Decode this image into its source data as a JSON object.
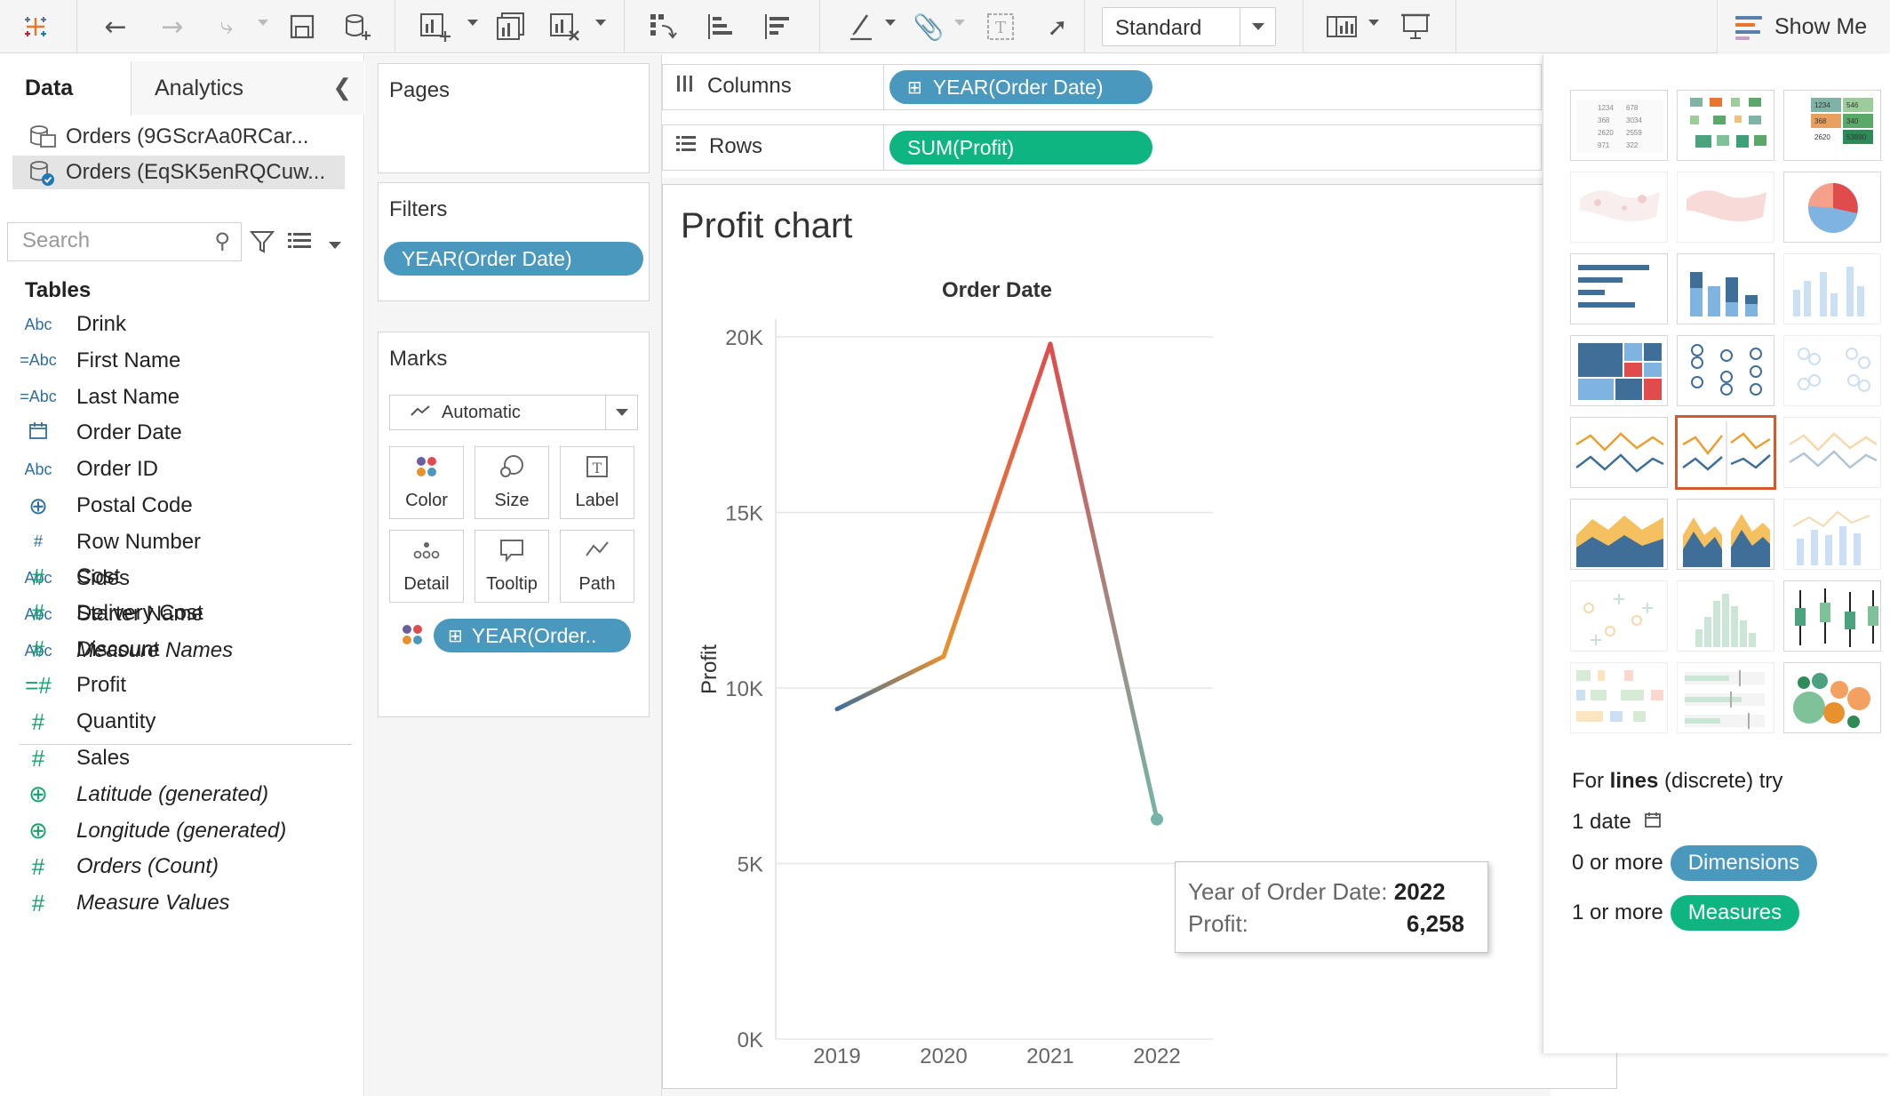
{
  "toolbar": {
    "layout_mode": "Standard",
    "show_me_label": "Show Me"
  },
  "left_panel": {
    "tabs": {
      "data": "Data",
      "analytics": "Analytics"
    },
    "data_sources": [
      {
        "label": "Orders (9GScrAa0RCar...",
        "selected": false
      },
      {
        "label": "Orders (EqSK5enRQCuw...",
        "selected": true
      }
    ],
    "search_placeholder": "Search",
    "tables_header": "Tables",
    "dimensions": [
      {
        "type": "Abc",
        "name": "Drink"
      },
      {
        "type": "=Abc",
        "name": "First Name"
      },
      {
        "type": "=Abc",
        "name": "Last Name"
      },
      {
        "type": "date",
        "name": "Order Date"
      },
      {
        "type": "Abc",
        "name": "Order ID"
      },
      {
        "type": "geo",
        "name": "Postal Code"
      },
      {
        "type": "#",
        "name": "Row Number"
      },
      {
        "type": "Abc",
        "name": "Sides"
      },
      {
        "type": "Abc",
        "name": "Starter Name"
      },
      {
        "type": "Abc",
        "name": "Measure Names",
        "italic": true
      }
    ],
    "measures": [
      {
        "type": "#",
        "name": "Cost"
      },
      {
        "type": "#",
        "name": "Delivery Cost"
      },
      {
        "type": "#",
        "name": "Discount"
      },
      {
        "type": "=#",
        "name": "Profit"
      },
      {
        "type": "#",
        "name": "Quantity"
      },
      {
        "type": "#",
        "name": "Sales"
      },
      {
        "type": "geo",
        "name": "Latitude (generated)",
        "italic": true
      },
      {
        "type": "geo",
        "name": "Longitude (generated)",
        "italic": true
      },
      {
        "type": "#",
        "name": "Orders (Count)",
        "italic": true
      },
      {
        "type": "#",
        "name": "Measure Values",
        "italic": true
      }
    ]
  },
  "cards": {
    "pages_title": "Pages",
    "filters_title": "Filters",
    "filter_pill": "YEAR(Order Date)",
    "marks_title": "Marks",
    "marks_type": "Automatic",
    "mark_buttons": {
      "color": "Color",
      "size": "Size",
      "label": "Label",
      "detail": "Detail",
      "tooltip": "Tooltip",
      "path": "Path"
    },
    "color_pill": "YEAR(Order.."
  },
  "shelves": {
    "columns_label": "Columns",
    "columns_pill": "YEAR(Order Date)",
    "rows_label": "Rows",
    "rows_pill": "SUM(Profit)"
  },
  "viz": {
    "title": "Profit chart",
    "header": "Order Date"
  },
  "chart_data": {
    "type": "line",
    "title": "Profit chart",
    "xlabel": "Order Date",
    "ylabel": "Profit",
    "categories": [
      "2019",
      "2020",
      "2021",
      "2022"
    ],
    "series": [
      {
        "values": [
          9400,
          10900,
          19800,
          6258
        ]
      }
    ],
    "ylim": [
      0,
      20000
    ],
    "yticks": [
      "0K",
      "5K",
      "10K",
      "15K",
      "20K"
    ],
    "colors": [
      "#3f6f99",
      "#e8912f",
      "#e04c4c",
      "#74b5a8"
    ],
    "grid": true
  },
  "tooltip": {
    "row1_label": "Year of Order Date:",
    "row1_value": "2022",
    "row2_label": "Profit:",
    "row2_value": "6,258"
  },
  "show_me": {
    "hint_prefix": "For",
    "hint_bold": "lines",
    "hint_suffix": "(discrete) try",
    "req1": "1 date",
    "req2_prefix": "0 or more",
    "req2_pill": "Dimensions",
    "req3_prefix": "1 or more",
    "req3_pill": "Measures",
    "thumb_text_table": [
      "1234",
      "678",
      "368",
      "3034",
      "2620",
      "2559",
      "971",
      "322"
    ],
    "thumb_text_highlight": [
      "1234",
      "546",
      "368",
      "340",
      "2620",
      "53890"
    ]
  }
}
